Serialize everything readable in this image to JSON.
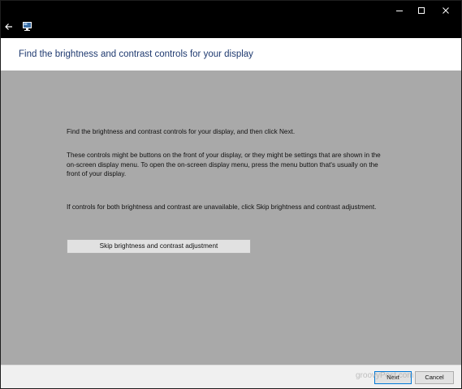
{
  "titlebar": {
    "back_icon": "back-arrow-icon",
    "app_icon": "display-calibration-icon",
    "controls": [
      "minimize-icon",
      "maximize-icon",
      "close-icon"
    ]
  },
  "header": {
    "title": "Find the brightness and contrast controls for your display"
  },
  "content": {
    "paragraph1": "Find the brightness and contrast controls for your display, and then click Next.",
    "paragraph2": "These controls might be buttons on the front of your display, or they might be settings that are shown in the on-screen display menu. To open the on-screen display menu, press the menu button that's usually on the front of your display.",
    "paragraph3": "If controls for both brightness and contrast are unavailable, click Skip brightness and contrast adjustment.",
    "skip_button": "Skip brightness and contrast adjustment"
  },
  "footer": {
    "next_label": "Next",
    "cancel_label": "Cancel"
  },
  "watermark": "groovyPost.com",
  "colors": {
    "content_bg": "#a9a9a9",
    "titlebar_bg": "#000000",
    "header_text": "#1f3a70",
    "accent": "#0078d7"
  }
}
